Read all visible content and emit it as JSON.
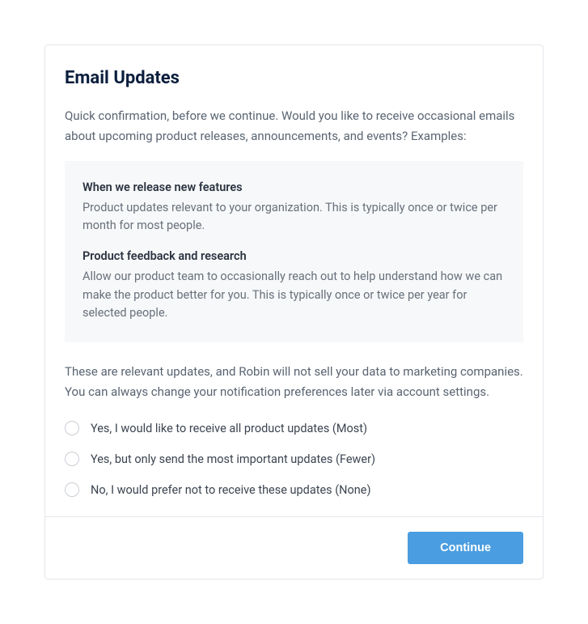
{
  "title": "Email Updates",
  "intro": "Quick confirmation, before we continue. Would you like to receive occasional emails about upcoming product releases, announcements, and events? Examples:",
  "examples": [
    {
      "title": "When we release new features",
      "desc": "Product updates relevant to your organization. This is typically once or twice per month for most people."
    },
    {
      "title": "Product feedback and research",
      "desc": "Allow our product team to occasionally reach out to help understand how we can make the product better for you. This is typically once or twice per year for selected people."
    }
  ],
  "note": "These are relevant updates, and Robin will not sell your data to marketing companies. You can always change your notification preferences later via account settings.",
  "options": [
    {
      "label": "Yes, I would like to receive all product updates (Most)"
    },
    {
      "label": "Yes, but only send the most important updates (Fewer)"
    },
    {
      "label": "No, I would prefer not to receive these updates (None)"
    }
  ],
  "footer": {
    "continue_label": "Continue"
  }
}
